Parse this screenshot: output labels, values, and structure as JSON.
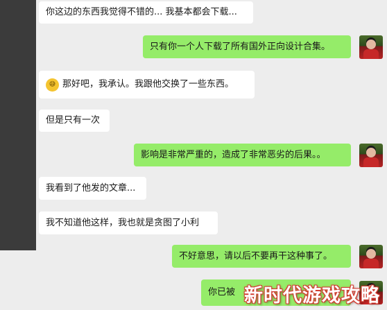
{
  "messages": [
    {
      "side": "in",
      "text": "你这边的东西我觉得不错的... 我基本都会下载..."
    },
    {
      "side": "out",
      "text": "只有你一个人下载了所有国外正向设计合集。"
    },
    {
      "side": "in",
      "text": "那好吧，我承认。我跟他交换了一些东西。",
      "emoji": "grinning-sweat-emoji"
    },
    {
      "side": "in",
      "text": "但是只有一次"
    },
    {
      "side": "out",
      "text": "影响是非常严重的，造成了非常恶劣的后果。。"
    },
    {
      "side": "in",
      "text": "我看到了他发的文章..."
    },
    {
      "side": "in",
      "text": "我不知道他这样，我也就是贪图了小利"
    },
    {
      "side": "out",
      "text": "不好意思，请以后不要再干这种事了。"
    },
    {
      "side": "out",
      "text": "你已被"
    }
  ],
  "watermark": "新时代游戏攻略",
  "colors": {
    "background": "#ededed",
    "incoming_bubble": "#ffffff",
    "outgoing_bubble": "#95ec69",
    "side_strip": "#3b3b3b",
    "watermark_outline": "#d23b2f"
  },
  "icons": {
    "emoji": "grinning-sweat-emoji",
    "avatar": "user-avatar"
  }
}
